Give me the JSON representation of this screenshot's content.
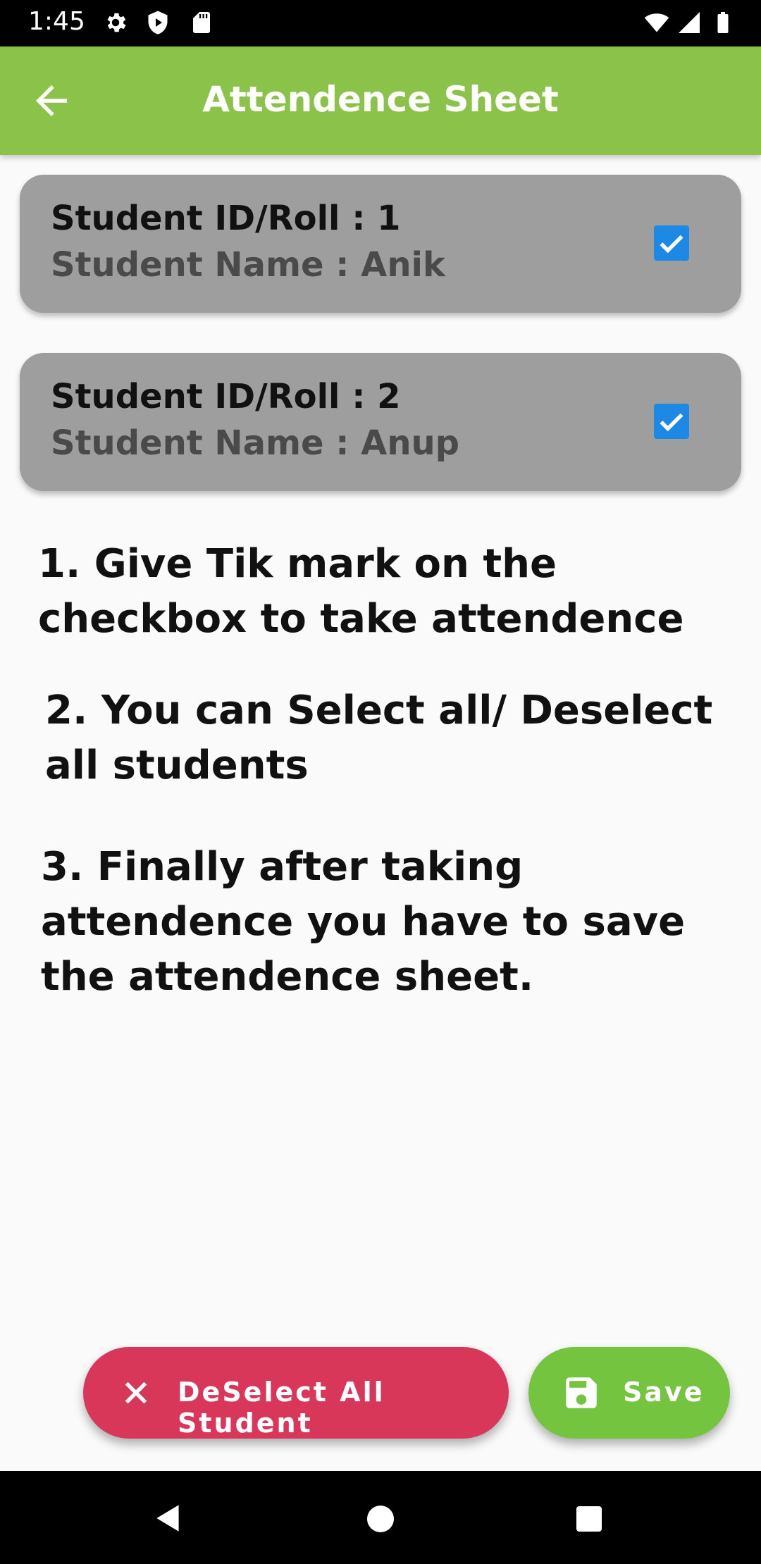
{
  "status_bar": {
    "time": "1:45",
    "icons": [
      "gear-icon",
      "shield-play-icon",
      "sd-card-icon",
      "wifi-icon",
      "signal-icon",
      "battery-icon"
    ]
  },
  "app_bar": {
    "title": "Attendence Sheet",
    "back_icon": "arrow-left-icon",
    "color": "#8bc34a"
  },
  "students": [
    {
      "roll": "Student ID/Roll : 1",
      "name": "Student Name : Anik",
      "checked": true
    },
    {
      "roll": "Student ID/Roll : 2",
      "name": "Student Name : Anup",
      "checked": true
    }
  ],
  "instructions": {
    "step1": "1. Give Tik mark on the checkbox to take attendence",
    "step2": "2. You can Select all/ Deselect all students",
    "step3": "3. Finally after taking attendence you have to save the attendence sheet."
  },
  "actions": {
    "deselect_label": "DeSelect All Student",
    "deselect_icon": "close-icon",
    "deselect_color": "#d8375a",
    "save_label": "Save",
    "save_icon": "floppy-disk-icon",
    "save_color": "#74c43f"
  },
  "nav_bar": {
    "icons": [
      "back-triangle-icon",
      "home-circle-icon",
      "recents-square-icon"
    ]
  }
}
